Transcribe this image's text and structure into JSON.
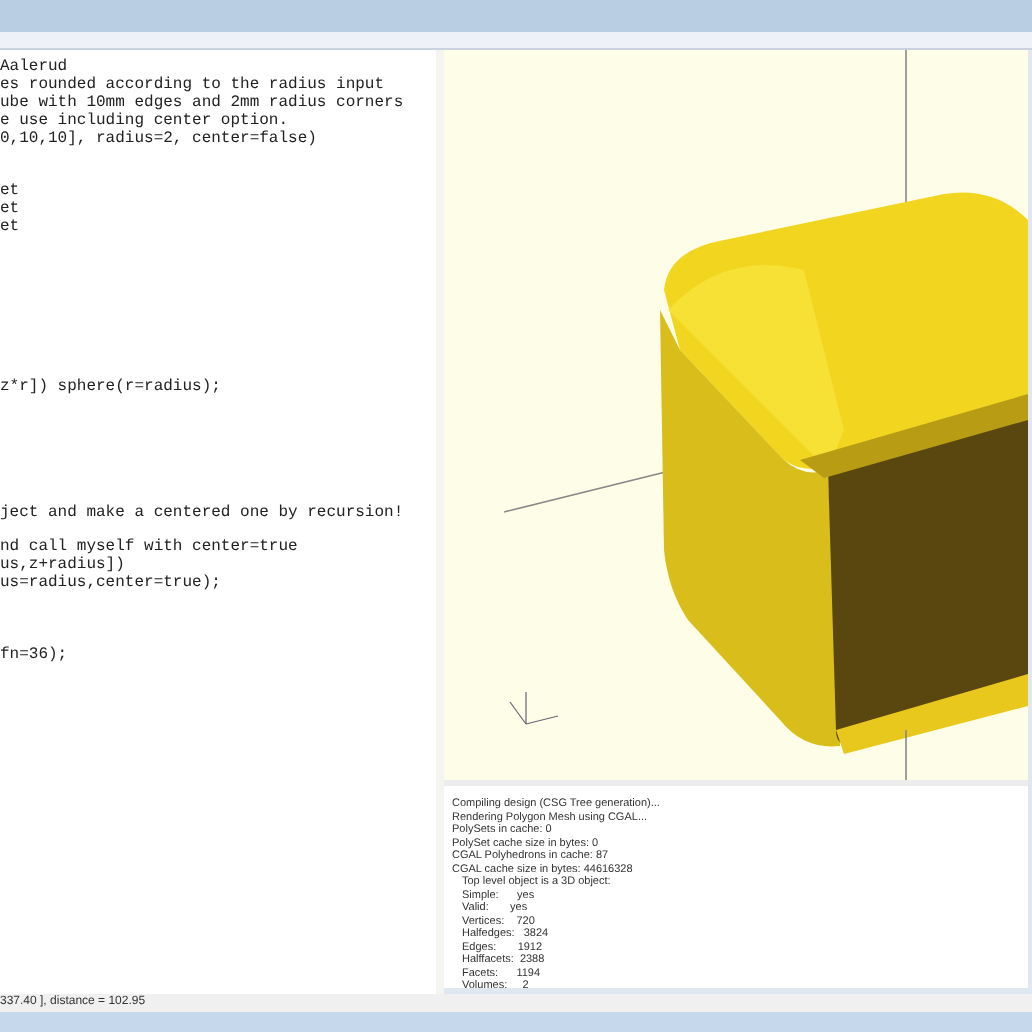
{
  "editor": {
    "blocks": [
      {
        "lines": [
          "Aalerud",
          "es rounded according to the radius input",
          "ube with 10mm edges and 2mm radius corners",
          "e use including center option.",
          "0,10,10], radius=2, center=false)"
        ]
      },
      {
        "lines": [
          "et",
          "et",
          "et"
        ]
      },
      {
        "lines": [
          "z*r]) sphere(r=radius);"
        ]
      },
      {
        "lines": [
          "ject and make a centered one by recursion!"
        ]
      },
      {
        "lines": [
          "nd call myself with center=true",
          "us,z+radius])",
          "us=radius,center=true);"
        ]
      },
      {
        "lines": [
          "fn=36);"
        ]
      }
    ]
  },
  "console": {
    "lines": [
      {
        "text": "Compiling design (CSG Tree generation)...",
        "indent": false
      },
      {
        "text": "Rendering Polygon Mesh using CGAL...",
        "indent": false
      },
      {
        "text": "PolySets in cache: 0",
        "indent": false
      },
      {
        "text": "PolySet cache size in bytes: 0",
        "indent": false
      },
      {
        "text": "CGAL Polyhedrons in cache: 87",
        "indent": false
      },
      {
        "text": "CGAL cache size in bytes: 44616328",
        "indent": false
      },
      {
        "text": "Top level object is a 3D object:",
        "indent": true
      },
      {
        "text": "Simple:      yes",
        "indent": true
      },
      {
        "text": "Valid:       yes",
        "indent": true
      },
      {
        "text": "Vertices:    720",
        "indent": true
      },
      {
        "text": "Halfedges:   3824",
        "indent": true
      },
      {
        "text": "Edges:       1912",
        "indent": true
      },
      {
        "text": "Halffacets:  2388",
        "indent": true
      },
      {
        "text": "Facets:      1194",
        "indent": true
      },
      {
        "text": "Volumes:     2",
        "indent": true
      }
    ]
  },
  "status_bar": {
    "text": "337.40 ], distance = 102.95"
  }
}
